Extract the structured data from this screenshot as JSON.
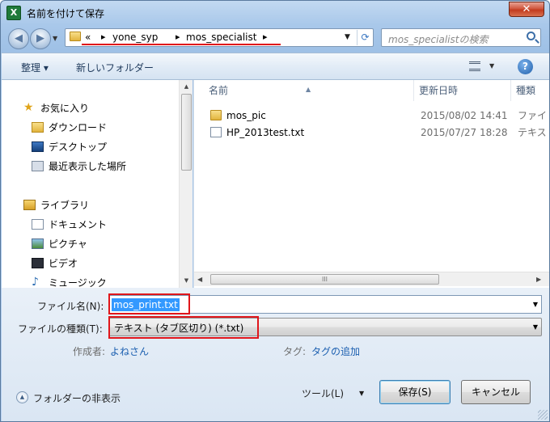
{
  "window": {
    "title": "名前を付けて保存",
    "app_icon_text": "X",
    "close_label": "✕"
  },
  "address": {
    "overflow": "«",
    "segments": [
      "yone_syp",
      "mos_specialist"
    ],
    "search_placeholder": "mos_specialistの検索"
  },
  "toolbar": {
    "organize": "整理 ▾",
    "new_folder": "新しいフォルダー",
    "help": "?"
  },
  "nav_pane": {
    "items": [
      {
        "label": "お気に入り",
        "icon": "star-icon"
      },
      {
        "label": "ダウンロード",
        "icon": "download-folder-icon"
      },
      {
        "label": "デスクトップ",
        "icon": "desktop-icon"
      },
      {
        "label": "最近表示した場所",
        "icon": "recent-places-icon"
      },
      {
        "label": "ライブラリ",
        "icon": "library-icon"
      },
      {
        "label": "ドキュメント",
        "icon": "document-icon"
      },
      {
        "label": "ピクチャ",
        "icon": "pictures-icon"
      },
      {
        "label": "ビデオ",
        "icon": "video-icon"
      },
      {
        "label": "ミュージック",
        "icon": "music-icon"
      }
    ]
  },
  "file_list": {
    "columns": [
      "名前",
      "更新日時",
      "種類"
    ],
    "rows": [
      {
        "name": "mos_pic",
        "date": "2015/08/02 14:41",
        "type": "ファイ",
        "icon": "folder-icon"
      },
      {
        "name": "HP_2013test.txt",
        "date": "2015/07/27 18:28",
        "type": "テキス",
        "icon": "text-file-icon"
      }
    ],
    "hscroll_grip": "III"
  },
  "form": {
    "filename_label": "ファイル名(N):",
    "filename_value": "mos_print.txt",
    "filetype_label": "ファイルの種類(T):",
    "filetype_value": "テキスト (タブ区切り) (*.txt)",
    "author_label": "作成者:",
    "author_value": "よねさん",
    "tags_label": "タグ:",
    "tags_value": "タグの追加"
  },
  "footer": {
    "hide_folders": "フォルダーの非表示",
    "tools": "ツール(L)",
    "save": "保存(S)",
    "cancel": "キャンセル"
  },
  "colors": {
    "highlight_box": "#e0161b",
    "selection": "#3399ff",
    "link": "#1b5fb0"
  }
}
